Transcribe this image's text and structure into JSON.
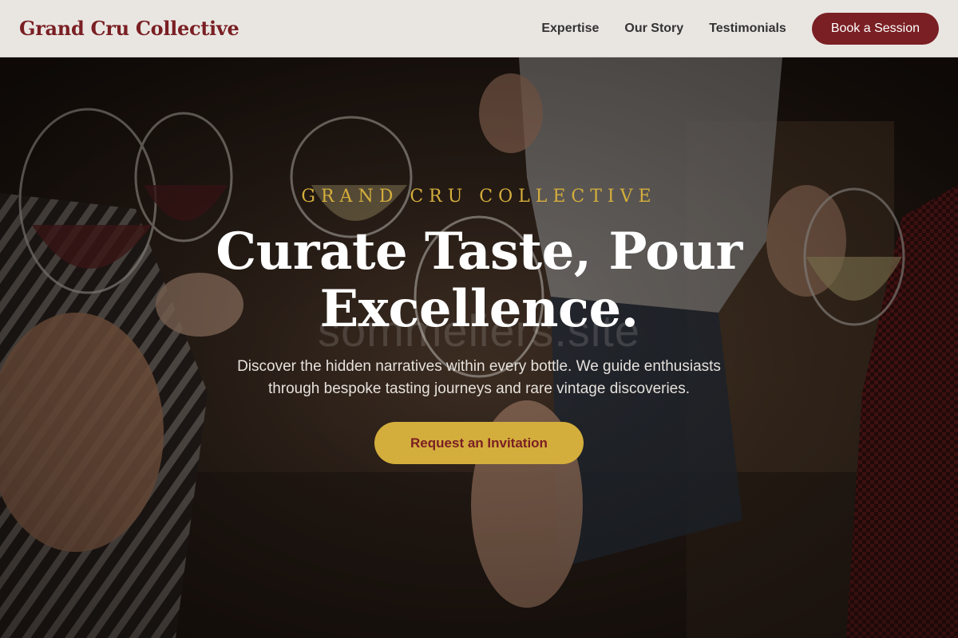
{
  "header": {
    "brand": "Grand Cru Collective",
    "nav": [
      {
        "label": "Expertise"
      },
      {
        "label": "Our Story"
      },
      {
        "label": "Testimonials"
      }
    ],
    "cta_label": "Book a Session"
  },
  "hero": {
    "eyebrow": "GRAND CRU COLLECTIVE",
    "headline_line1": "Curate Taste, Pour",
    "headline_line2": "Excellence.",
    "watermark": "sommeliers.site",
    "subtext_line1": "Discover the hidden narratives within every bottle. We guide enthusiasts",
    "subtext_line2": "through bespoke tasting journeys and rare vintage discoveries.",
    "cta_label": "Request an Invitation",
    "background_image": "wine-toast-photo"
  },
  "colors": {
    "brand": "#7a1f23",
    "accent_gold": "#d4ae3c",
    "header_bg": "#e9e6e2",
    "hero_text": "#ffffff"
  }
}
